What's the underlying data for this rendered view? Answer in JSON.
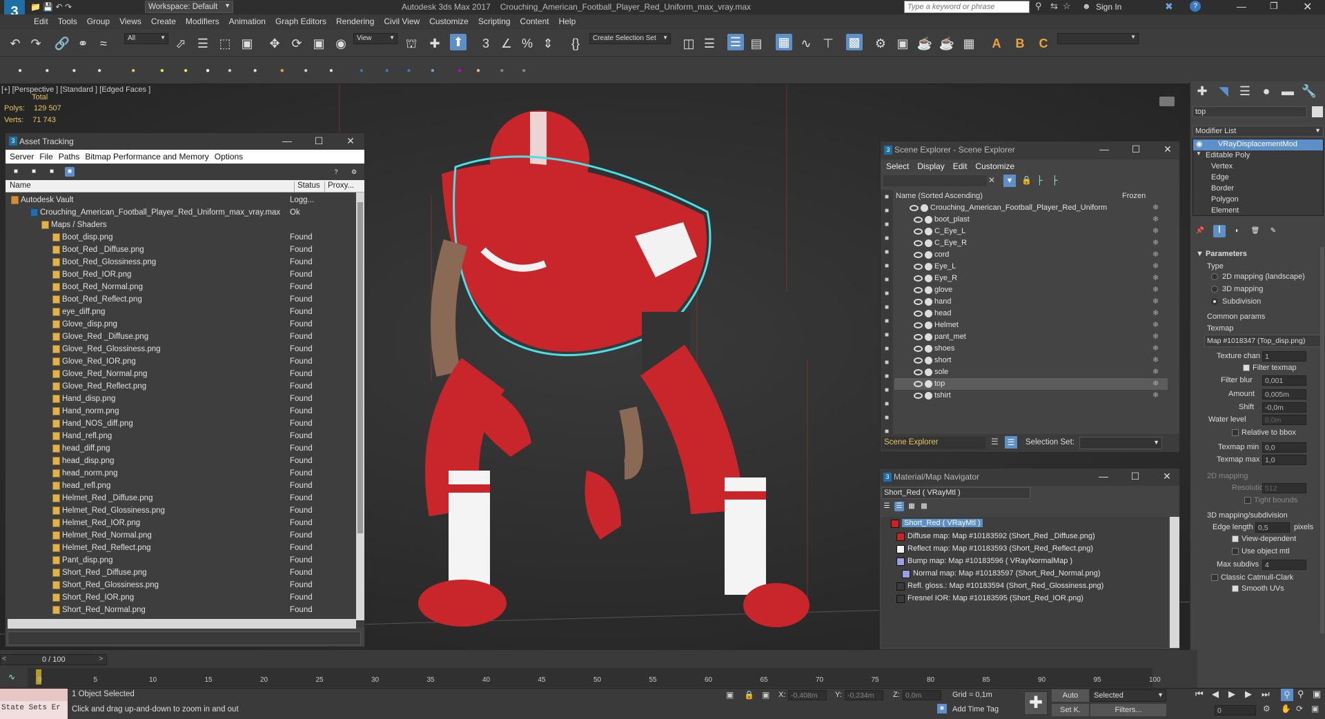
{
  "app": {
    "title": "Autodesk 3ds Max 2017",
    "file": "Crouching_American_Football_Player_Red_Uniform_max_vray.max",
    "workspace": "Workspace: Default",
    "search_placeholder": "Type a keyword or phrase",
    "sign_in": "Sign In"
  },
  "menu": [
    "Edit",
    "Tools",
    "Group",
    "Views",
    "Create",
    "Modifiers",
    "Animation",
    "Graph Editors",
    "Rendering",
    "Civil View",
    "Customize",
    "Scripting",
    "Content",
    "Help"
  ],
  "toolbar": {
    "selection_filter": "All",
    "ref_coord": "View",
    "named_selection": "Create Selection Set"
  },
  "viewport": {
    "label": "[+] [Perspective ] [Standard ] [Edged Faces ]",
    "stats_header": "Total",
    "polys_label": "Polys:",
    "polys_value": "129 507",
    "verts_label": "Verts:",
    "verts_value": "71 743"
  },
  "asset_tracking": {
    "title": "Asset Tracking",
    "menu": [
      "Server",
      "File",
      "Paths",
      "Bitmap Performance and Memory",
      "Options"
    ],
    "col_name": "Name",
    "col_status": "Status",
    "col_proxy": "Proxy...",
    "vault": {
      "name": "Autodesk Vault",
      "status": "Logg..."
    },
    "max_file": {
      "name": "Crouching_American_Football_Player_Red_Uniform_max_vray.max",
      "status": "Ok"
    },
    "group": "Maps / Shaders",
    "files": [
      {
        "name": "Boot_disp.png",
        "status": "Found"
      },
      {
        "name": "Boot_Red _Diffuse.png",
        "status": "Found"
      },
      {
        "name": "Boot_Red_Glossiness.png",
        "status": "Found"
      },
      {
        "name": "Boot_Red_IOR.png",
        "status": "Found"
      },
      {
        "name": "Boot_Red_Normal.png",
        "status": "Found"
      },
      {
        "name": "Boot_Red_Reflect.png",
        "status": "Found"
      },
      {
        "name": "eye_diff.png",
        "status": "Found"
      },
      {
        "name": "Glove_disp.png",
        "status": "Found"
      },
      {
        "name": "Glove_Red _Diffuse.png",
        "status": "Found"
      },
      {
        "name": "Glove_Red_Glossiness.png",
        "status": "Found"
      },
      {
        "name": "Glove_Red_IOR.png",
        "status": "Found"
      },
      {
        "name": "Glove_Red_Normal.png",
        "status": "Found"
      },
      {
        "name": "Glove_Red_Reflect.png",
        "status": "Found"
      },
      {
        "name": "Hand_disp.png",
        "status": "Found"
      },
      {
        "name": "Hand_norm.png",
        "status": "Found"
      },
      {
        "name": "Hand_NOS_diff.png",
        "status": "Found"
      },
      {
        "name": "Hand_refl.png",
        "status": "Found"
      },
      {
        "name": "head_diff.png",
        "status": "Found"
      },
      {
        "name": "head_disp.png",
        "status": "Found"
      },
      {
        "name": "head_norm.png",
        "status": "Found"
      },
      {
        "name": "head_refl.png",
        "status": "Found"
      },
      {
        "name": "Helmet_Red _Diffuse.png",
        "status": "Found"
      },
      {
        "name": "Helmet_Red_Glossiness.png",
        "status": "Found"
      },
      {
        "name": "Helmet_Red_IOR.png",
        "status": "Found"
      },
      {
        "name": "Helmet_Red_Normal.png",
        "status": "Found"
      },
      {
        "name": "Helmet_Red_Reflect.png",
        "status": "Found"
      },
      {
        "name": "Pant_disp.png",
        "status": "Found"
      },
      {
        "name": "Short_Red _Diffuse.png",
        "status": "Found"
      },
      {
        "name": "Short_Red_Glossiness.png",
        "status": "Found"
      },
      {
        "name": "Short_Red_IOR.png",
        "status": "Found"
      },
      {
        "name": "Short_Red_Normal.png",
        "status": "Found"
      }
    ]
  },
  "scene_explorer": {
    "title": "Scene Explorer - Scene Explorer",
    "menu": [
      "Select",
      "Display",
      "Edit",
      "Customize"
    ],
    "col_name": "Name (Sorted Ascending)",
    "col_frozen": "Frozen",
    "root": "Crouching_American_Football_Player_Red_Uniform",
    "objects": [
      "boot_plast",
      "C_Eye_L",
      "C_Eye_R",
      "cord",
      "Eye_L",
      "Eye_R",
      "glove",
      "hand",
      "head",
      "Helmet",
      "pant_met",
      "shoes",
      "short",
      "sole",
      "top",
      "tshirt"
    ],
    "selected": "top",
    "footer_label": "Scene Explorer",
    "selection_set_label": "Selection Set:"
  },
  "material_navigator": {
    "title": "Material/Map Navigator",
    "current": "Short_Red  ( VRayMtl )",
    "root": "Short_Red  ( VRayMtl )",
    "maps": [
      {
        "label": "Diffuse map: Map #10183592 (Short_Red _Diffuse.png)",
        "color": "#cc2222"
      },
      {
        "label": "Reflect map: Map #10183593 (Short_Red_Reflect.png)",
        "color": "#f2f2f2"
      },
      {
        "label": "Bump map: Map #10183596  ( VRayNormalMap )",
        "color": "#9aa0e6"
      },
      {
        "label": "Normal map: Map #10183597 (Short_Red_Normal.png)",
        "color": "#9aa0e6"
      },
      {
        "label": "Refl. gloss.: Map #10183594 (Short_Red_Glossiness.png)",
        "color": "#3a3a3a"
      },
      {
        "label": "Fresnel IOR: Map #10183595 (Short_Red_IOR.png)",
        "color": "#3a3a3a"
      }
    ]
  },
  "command_panel": {
    "object_name": "top",
    "modifier_list": "Modifier List",
    "stack": [
      "VRayDisplacementMod",
      "Editable Poly",
      "Vertex",
      "Edge",
      "Border",
      "Polygon",
      "Element"
    ],
    "params_title": "Parameters",
    "type_label": "Type",
    "type_options": [
      "2D mapping (landscape)",
      "3D mapping",
      "Subdivision"
    ],
    "type_selected": "Subdivision",
    "common_params": "Common params",
    "texmap_label": "Texmap",
    "texmap_value": "Map #1018347 (Top_disp.png)",
    "texture_chan_label": "Texture chan",
    "texture_chan_value": "1",
    "filter_texmap": "Filter texmap",
    "filter_blur_label": "Filter blur",
    "filter_blur_value": "0,001",
    "amount_label": "Amount",
    "amount_value": "0,005m",
    "shift_label": "Shift",
    "shift_value": "-0,0m",
    "water_level_label": "Water level",
    "water_level_value": "0,0m",
    "relative_bbox": "Relative to bbox",
    "texmap_min_label": "Texmap min",
    "texmap_min_value": "0,0",
    "texmap_max_label": "Texmap max",
    "texmap_max_value": "1,0",
    "mapping2d": "2D mapping",
    "resolution_label": "Resolution",
    "resolution_value": "512",
    "tight_bounds": "Tight bounds",
    "mapping3d": "3D mapping/subdivision",
    "edge_length_label": "Edge length",
    "edge_length_value": "0,5",
    "edge_length_unit": "pixels",
    "view_dependent": "View-dependent",
    "use_object_mtl": "Use object mtl",
    "max_subdivs_label": "Max subdivs",
    "max_subdivs_value": "4",
    "catmull": "Classic Catmull-Clark",
    "smooth_uvs": "Smooth UVs"
  },
  "timeline": {
    "frame": "0 / 100",
    "ticks": [
      "0",
      "5",
      "10",
      "15",
      "20",
      "25",
      "30",
      "35",
      "40",
      "45",
      "50",
      "55",
      "60",
      "65",
      "70",
      "75",
      "80",
      "85",
      "90",
      "95",
      "100"
    ]
  },
  "status": {
    "state_sets": "State Sets Er",
    "selected": "1 Object Selected",
    "hint": "Click and drag up-and-down to zoom in and out",
    "x_label": "X:",
    "x_value": "-0,408m",
    "y_label": "Y:",
    "y_value": "-0,234m",
    "z_label": "Z:",
    "z_value": "0,0m",
    "grid": "Grid = 0,1m",
    "add_time_tag": "Add Time Tag",
    "auto": "Auto",
    "set_key": "Set K.",
    "key_filter": "Selected",
    "filters": "Filters...",
    "frame_field": "0"
  }
}
